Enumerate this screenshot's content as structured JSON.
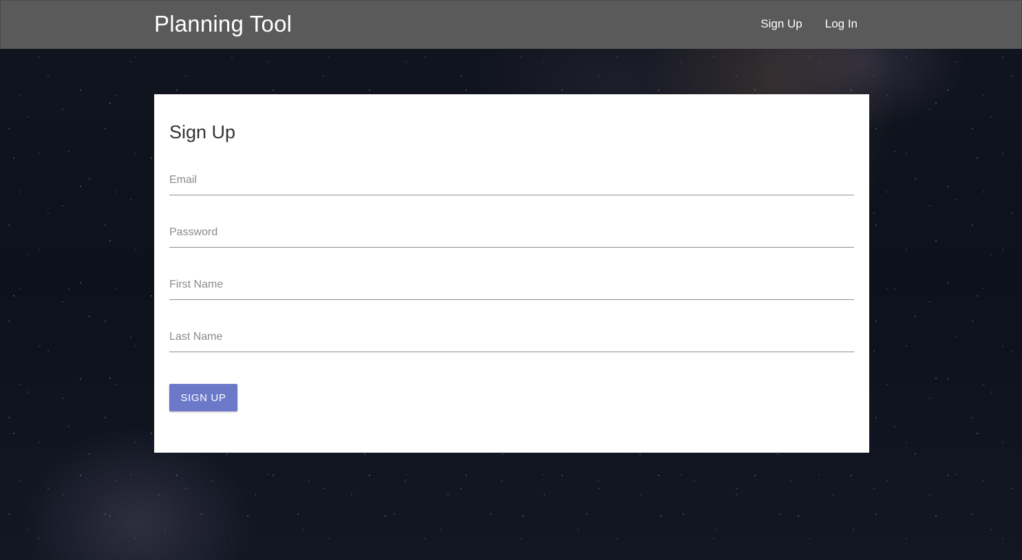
{
  "navbar": {
    "brand": "Planning Tool",
    "links": [
      {
        "label": "Sign Up"
      },
      {
        "label": "Log In"
      }
    ]
  },
  "form": {
    "title": "Sign Up",
    "fields": [
      {
        "placeholder": "Email",
        "value": ""
      },
      {
        "placeholder": "Password",
        "value": ""
      },
      {
        "placeholder": "First Name",
        "value": ""
      },
      {
        "placeholder": "Last Name",
        "value": ""
      }
    ],
    "submit_label": "SIGN UP"
  },
  "colors": {
    "navbar_bg": "#5a5a5a",
    "button_bg": "#6c79c8",
    "card_bg": "#ffffff"
  }
}
